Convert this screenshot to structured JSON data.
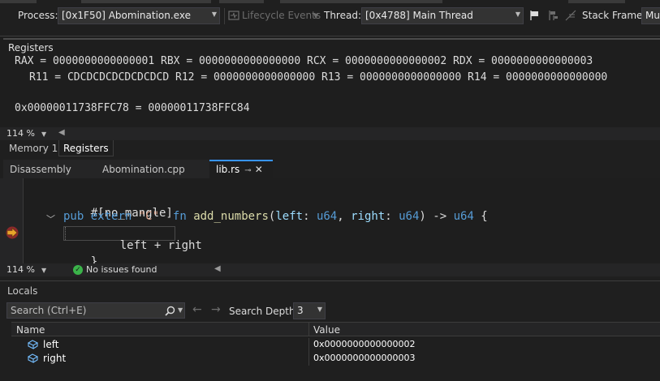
{
  "toolbar": {
    "process_label": "Process:",
    "process_value": "[0x1F50] Abomination.exe",
    "lifecycle_label": "Lifecycle Events",
    "thread_label": "Thread:",
    "thread_value": "[0x4788] Main Thread",
    "stack_frame_label": "Stack Frame:",
    "stack_frame_value": "Mu"
  },
  "registers": {
    "title": "Registers",
    "line1": "RAX = 0000000000000001 RBX = 0000000000000000 RCX = 0000000000000002 RDX = 0000000000000003",
    "line2": "R11 = CDCDCDCDCDCDCDCD R12 = 0000000000000000 R13 = 0000000000000000 R14 = 0000000000000000",
    "line3": "0x00000011738FFC78 = 00000011738FFC84",
    "zoom": "114 %"
  },
  "bottom_tabs": [
    {
      "label": "Memory 1"
    },
    {
      "label": "Registers"
    }
  ],
  "doc_tabs": [
    {
      "label": "Disassembly"
    },
    {
      "label": "Abomination.cpp"
    },
    {
      "label": "lib.rs"
    }
  ],
  "code": {
    "attr": "#[no_mangle]",
    "kw_pub": "pub",
    "kw_extern": "extern",
    "abi": "\"C\"",
    "kw_fn": "fn",
    "fn_name": "add_numbers",
    "open_paren": "(",
    "p1": "left",
    "colon1": ": ",
    "t1": "u64",
    "comma": ", ",
    "p2": "right",
    "colon2": ": ",
    "t2": "u64",
    "close_arrow": ") -> ",
    "ret": "u64",
    "brace_open": " {",
    "body": "left + right",
    "brace_close": "}"
  },
  "editor_status": {
    "zoom": "114 %",
    "issues": "No issues found"
  },
  "locals": {
    "title": "Locals",
    "search_placeholder": "Search (Ctrl+E)",
    "search_depth_label": "Search Depth:",
    "search_depth_value": "3",
    "columns": {
      "name": "Name",
      "value": "Value"
    },
    "rows": [
      {
        "name": "left",
        "value": "0x0000000000000002"
      },
      {
        "name": "right",
        "value": "0x0000000000000003"
      }
    ]
  },
  "colors": {
    "accent": "#3794ff",
    "breakpoint_arrow": "#e8a52a",
    "ok_green": "#3bb44a"
  }
}
